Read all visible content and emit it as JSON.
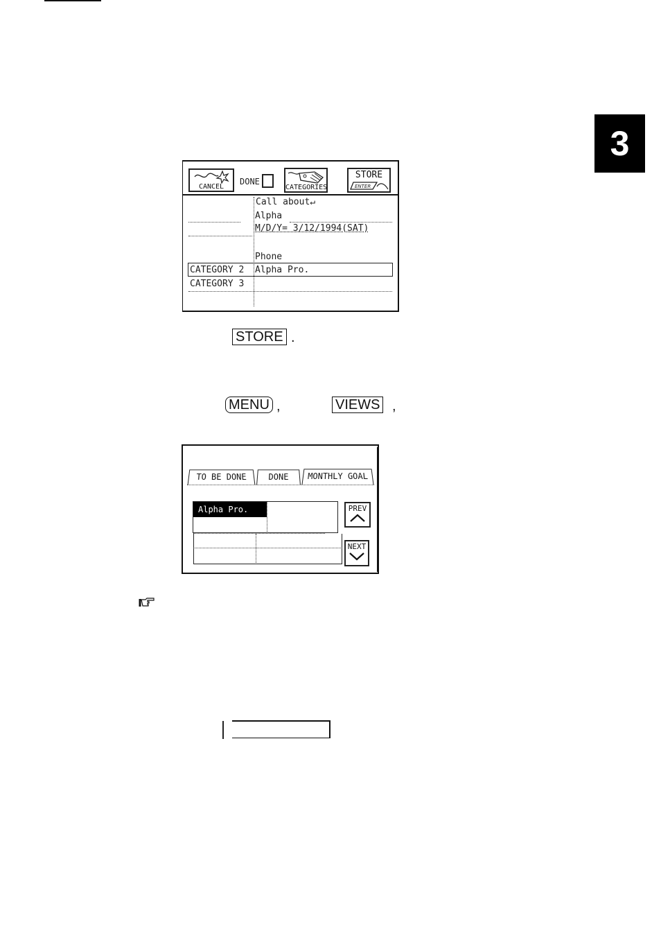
{
  "page": {
    "chapter_number": "3"
  },
  "screen1": {
    "toolbar": {
      "cancel_label": "CANCEL",
      "done_label": "DONE",
      "categories_label": "CATEGORIES",
      "store_label": "STORE",
      "store_sublabel": "ENTER"
    },
    "memo_lines": [
      "Call      about↵",
      "Alpha",
      "M/D/Y= 3/12/1994(SAT)",
      "",
      "Phone"
    ],
    "categories": [
      {
        "label": "CATEGORY 2",
        "value": "Alpha Pro."
      },
      {
        "label": "CATEGORY 3",
        "value": ""
      }
    ]
  },
  "instructions": {
    "store_key": "STORE",
    "store_punct": ".",
    "menu_key": "MENU",
    "menu_punct": ",",
    "views_key": "VIEWS",
    "views_punct": ","
  },
  "screen2": {
    "tabs": [
      {
        "label": "TO BE DONE"
      },
      {
        "label": "DONE"
      },
      {
        "label": "MONTHLY GOAL"
      }
    ],
    "selected_item": "Alpha Pro.",
    "prev_label": "PREV",
    "next_label": "NEXT"
  }
}
